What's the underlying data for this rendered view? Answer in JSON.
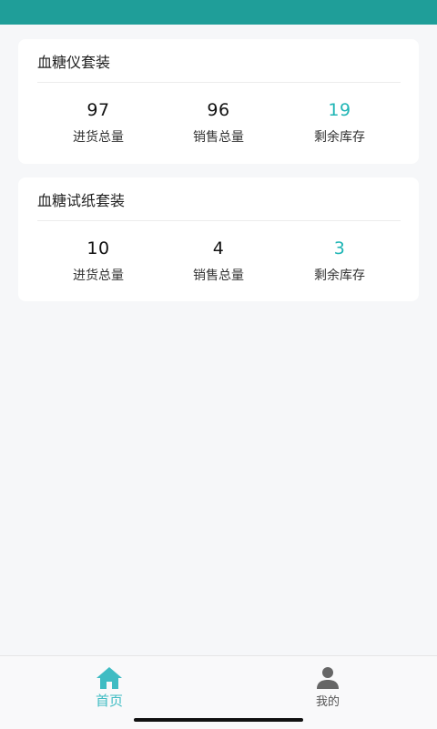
{
  "colors": {
    "top_bar": "#1f9e99",
    "accent": "#1fb5b5",
    "tab_active": "#3fbcc3",
    "tab_inactive": "#555555",
    "background": "#f6f7f9"
  },
  "cards": [
    {
      "title": "血糖仪套装",
      "stats": [
        {
          "value": "97",
          "label": "进货总量"
        },
        {
          "value": "96",
          "label": "销售总量"
        },
        {
          "value": "19",
          "label": "剩余库存"
        }
      ]
    },
    {
      "title": "血糖试纸套装",
      "stats": [
        {
          "value": "10",
          "label": "进货总量"
        },
        {
          "value": "4",
          "label": "销售总量"
        },
        {
          "value": "3",
          "label": "剩余库存"
        }
      ]
    }
  ],
  "tabs": [
    {
      "label": "首页",
      "icon": "home-icon",
      "active": true
    },
    {
      "label": "我的",
      "icon": "user-icon",
      "active": false
    }
  ]
}
